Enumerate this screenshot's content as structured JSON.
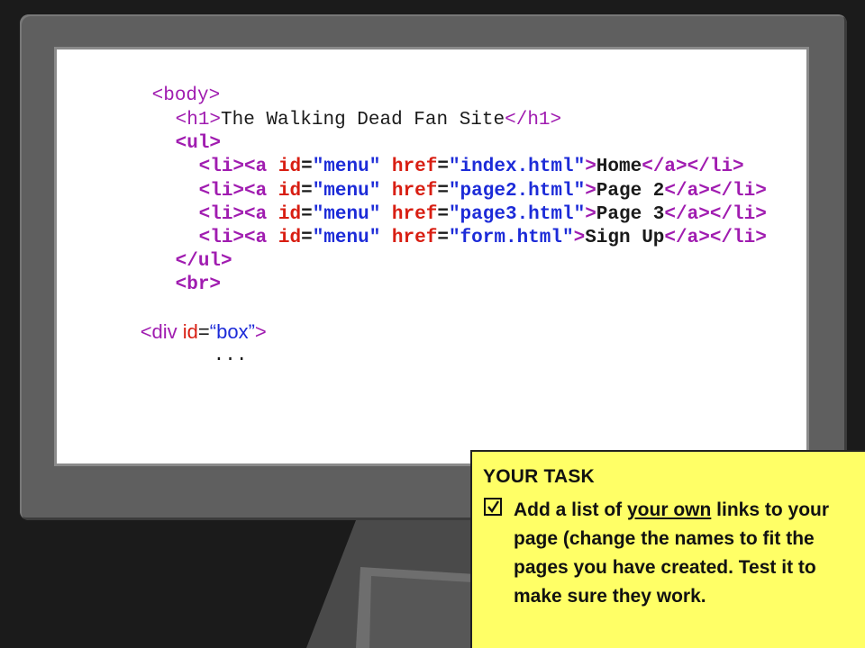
{
  "code": {
    "body_open": "<body>",
    "h1_open": "<h1>",
    "h1_text": "The Walking Dead Fan Site",
    "h1_close": "</h1>",
    "ul_open": "<ul>",
    "li_open": "<li>",
    "a_open": "<a ",
    "id_attr": "id",
    "href_attr": "href",
    "eq": "=",
    "id_value": "\"menu\"",
    "gt": ">",
    "a_close": "</a>",
    "li_close": "</li>",
    "links": [
      {
        "href": "\"index.html\"",
        "label": "Home"
      },
      {
        "href": "\"page2.html\"",
        "label": "Page 2"
      },
      {
        "href": "\"page3.html\"",
        "label": "Page 3"
      },
      {
        "href": "\"form.html\"",
        "label": "Sign Up"
      }
    ],
    "ul_close": "</ul>",
    "br": "<br>",
    "div_open": "<div ",
    "div_id_attr": "id",
    "div_eq": "=",
    "div_id_value": "“box”",
    "div_gt": ">",
    "ellipsis": "..."
  },
  "task": {
    "title": "YOUR TASK",
    "check_icon": "ballot-box-with-check",
    "text_before": "Add a list of ",
    "text_emphasis": "your own",
    "text_after": " links to your page (change the names to fit the pages you have created. Test it to make sure they work."
  },
  "colors": {
    "tag": "#a01cb0",
    "attribute": "#d81e12",
    "value": "#1c2bd8",
    "task_background": "#ffff66"
  }
}
